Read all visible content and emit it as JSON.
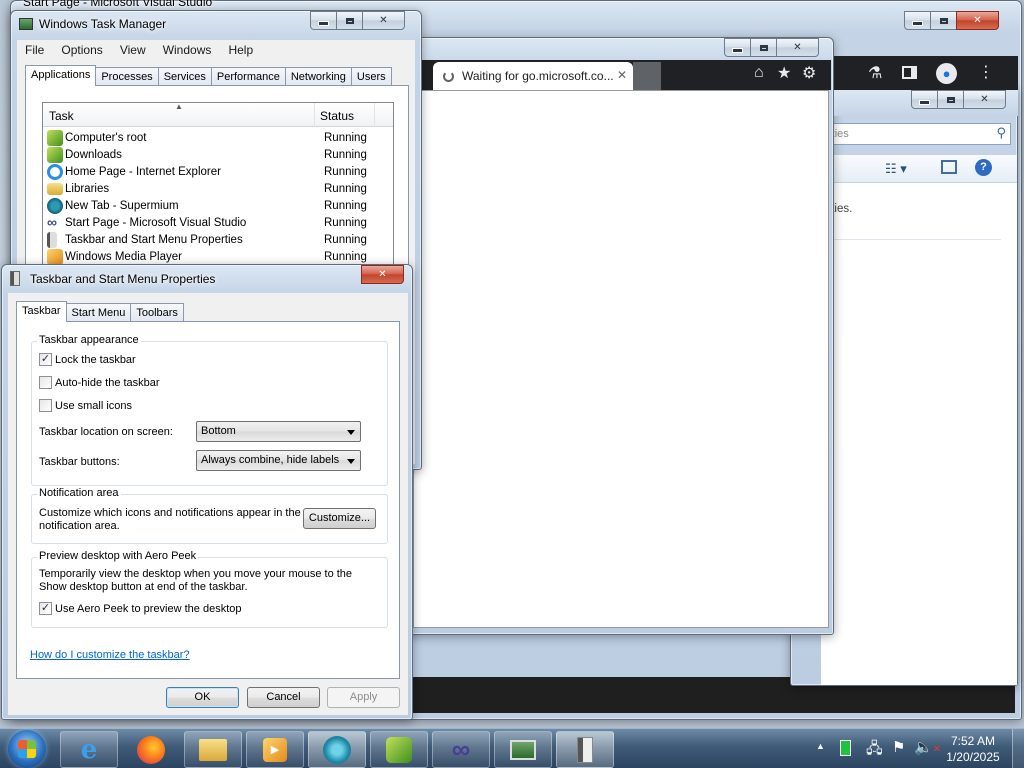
{
  "back_window_title": "Start Page - Microsoft Visual Studio",
  "explorer": {
    "search_placeholder_visible": "rties",
    "desc_fragment": "erties."
  },
  "browser": {
    "tab_title": "Waiting for go.microsoft.co..."
  },
  "task_manager": {
    "title": "Windows Task Manager",
    "menu": [
      "File",
      "Options",
      "View",
      "Windows",
      "Help"
    ],
    "tabs": [
      "Applications",
      "Processes",
      "Services",
      "Performance",
      "Networking",
      "Users"
    ],
    "columns": {
      "task": "Task",
      "status": "Status"
    },
    "rows": [
      {
        "task": "Computer's root",
        "status": "Running",
        "icon": "green-app-icon"
      },
      {
        "task": "Downloads",
        "status": "Running",
        "icon": "green-app-icon"
      },
      {
        "task": "Home Page - Internet Explorer",
        "status": "Running",
        "icon": "ie-icon"
      },
      {
        "task": "Libraries",
        "status": "Running",
        "icon": "folder-icon"
      },
      {
        "task": "New Tab - Supermium",
        "status": "Running",
        "icon": "supermium-icon"
      },
      {
        "task": "Start Page - Microsoft Visual Studio",
        "status": "Running",
        "icon": "visual-studio-icon"
      },
      {
        "task": "Taskbar and Start Menu Properties",
        "status": "Running",
        "icon": "taskbar-icon"
      },
      {
        "task": "Windows Media Player",
        "status": "Running",
        "icon": "media-player-icon"
      }
    ]
  },
  "props": {
    "title": "Taskbar and Start Menu Properties",
    "tabs": [
      "Taskbar",
      "Start Menu",
      "Toolbars"
    ],
    "appearance": {
      "title": "Taskbar appearance",
      "lock": {
        "label": "Lock the taskbar",
        "checked": true
      },
      "autohide": {
        "label": "Auto-hide the taskbar",
        "checked": false
      },
      "small_icons": {
        "label": "Use small icons",
        "checked": false
      },
      "location_label": "Taskbar location on screen:",
      "location_value": "Bottom",
      "buttons_label": "Taskbar buttons:",
      "buttons_value": "Always combine, hide labels"
    },
    "notification": {
      "title": "Notification area",
      "text": "Customize which icons and notifications appear in the notification area.",
      "button": "Customize..."
    },
    "peek": {
      "title": "Preview desktop with Aero Peek",
      "text": "Temporarily view the desktop when you move your mouse to the Show desktop button at end of the taskbar.",
      "checkbox": {
        "label": "Use Aero Peek to preview the desktop",
        "checked": true
      }
    },
    "help_link": "How do I customize the taskbar?",
    "buttons": {
      "ok": "OK",
      "cancel": "Cancel",
      "apply": "Apply"
    }
  },
  "taskbar": {
    "clock_time": "7:52 AM",
    "clock_date": "1/20/2025"
  },
  "colors": {
    "accent_blue": "#3c7fb1",
    "link": "#0066cc",
    "taskbar": "#3f5b78"
  }
}
